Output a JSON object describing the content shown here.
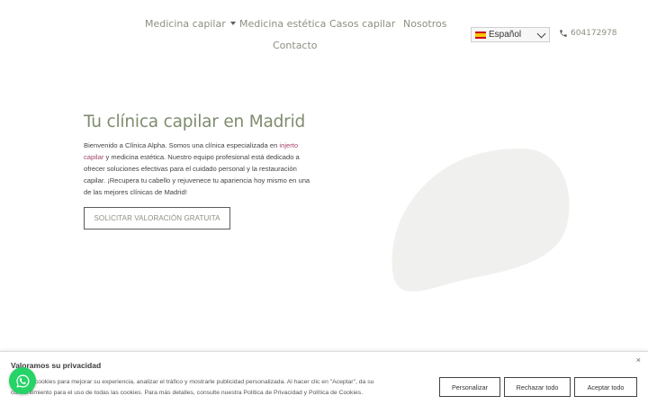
{
  "nav": {
    "items": [
      {
        "label": "Medicina capilar",
        "dropdown": true
      },
      {
        "label": "Medicina estética"
      },
      {
        "label": "Casos capilar"
      },
      {
        "label": "Nosotros"
      },
      {
        "label": "Contacto"
      }
    ],
    "language": {
      "selected": "Español",
      "icon": "spain-flag-icon"
    },
    "phone": {
      "number": "604172978",
      "icon": "phone-icon"
    }
  },
  "hero": {
    "title": "Tu clínica capilar en Madrid",
    "text_before_link": "Bienvenido a Clínica Alpha. Somos una clínica especializada en ",
    "link_text": "injerto capilar",
    "text_after_link": " y medicina estética. Nuestro equipo profesional está dedicado a ofrecer soluciones efectivas para el cuidado personal y la restauración capilar. ¡Recupera tu cabello y rejuvenece tu apariencia hoy mismo en una de las mejores clínicas de Madrid!",
    "cta_label": "SOLICITAR VALORACIÓN GRATUITA"
  },
  "cookie_banner": {
    "title": "Valoramos su privacidad",
    "text": "Usamos cookies para mejorar su experiencia, analizar el tráfico y mostrarle publicidad personalizada. Al hacer clic en \"Aceptar\", da su consentimiento para el uso de todas las cookies. Para más detalles, consulte nuestra Política de Privacidad y Política de Cookies.",
    "close_label": "×",
    "buttons": {
      "customize": "Personalizar",
      "reject": "Rechazar todo",
      "accept": "Aceptar todo"
    }
  },
  "colors": {
    "nav_text": "#8a9080",
    "hero_title": "#7f8c6f",
    "link": "#a2456e",
    "blob": "#f0f1ee",
    "whatsapp": "#25d366"
  },
  "floating": {
    "icon": "whatsapp-icon"
  }
}
